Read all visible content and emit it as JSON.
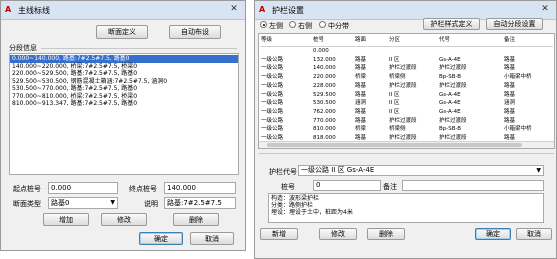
{
  "left": {
    "title": "主线标线",
    "btn_section_define": "断面定义",
    "btn_auto_layout": "自动布设",
    "group_label": "分段信息",
    "segments": [
      "0.000~140.000, 路基:7#2.5#7.5, 路基0",
      "140.000~220.000, 桥梁:7#2.5#7.5, 桥梁0",
      "220.000~529.500, 路基:7#2.5#7.5, 路基0",
      "529.500~530.500, 钢筋混凝土箱涵:7#2.5#7.5, 涵洞0",
      "530.500~770.000, 路基:7#2.5#7.5, 路基0",
      "770.000~810.000, 桥梁:7#2.5#7.5, 桥梁0",
      "810.000~913.347, 路基:7#2.5#7.5, 路基0"
    ],
    "start_label": "起点桩号",
    "start_value": "0.000",
    "end_label": "终点桩号",
    "end_value": "140.000",
    "type_label": "断面类型",
    "type_value": "路基0",
    "desc_label": "说明",
    "desc_value": "路基:7#2.5#7.5",
    "btn_add": "增加",
    "btn_modify": "修改",
    "btn_delete": "删除",
    "btn_ok": "确定",
    "btn_cancel": "取消"
  },
  "right": {
    "title": "护栏设置",
    "radio_left": "左侧",
    "radio_right": "右侧",
    "radio_median": "中分带",
    "btn_style": "护栏样式定义",
    "btn_auto": "自动分段设置",
    "headers": [
      "等级",
      "桩号",
      "路面",
      "分区",
      "代号",
      "备注"
    ],
    "rows": [
      [
        "",
        "0.000",
        "",
        "",
        "",
        ""
      ],
      [
        "一级公路",
        "132.000",
        "路基",
        "II 区",
        "Gs-A-4E",
        "路基"
      ],
      [
        "一级公路",
        "140.000",
        "路基",
        "护栏过渡段",
        "护栏过渡段",
        "路基"
      ],
      [
        "一级公路",
        "220.000",
        "桥梁",
        "桥梁侧",
        "Bp-SB-B",
        "小箱梁中桥"
      ],
      [
        "一级公路",
        "228.000",
        "路基",
        "护栏过渡段",
        "护栏过渡段",
        "路基"
      ],
      [
        "一级公路",
        "529.500",
        "路基",
        "II 区",
        "Gs-A-4E",
        "路基"
      ],
      [
        "一级公路",
        "530.500",
        "涵洞",
        "II 区",
        "Gs-A-4E",
        "涵洞"
      ],
      [
        "一级公路",
        "762.000",
        "路基",
        "II 区",
        "Gs-A-4E",
        "路基"
      ],
      [
        "一级公路",
        "770.000",
        "路基",
        "护栏过渡段",
        "护栏过渡段",
        "路基"
      ],
      [
        "一级公路",
        "810.000",
        "桥梁",
        "桥梁侧",
        "Bp-SB-B",
        "小箱梁中桥"
      ],
      [
        "一级公路",
        "818.000",
        "路基",
        "护栏过渡段",
        "护栏过渡段",
        "路基"
      ],
      [
        "一级公路",
        "913.347",
        "路基",
        "II 区",
        "Gs-A-4E",
        "路基"
      ]
    ],
    "code_label": "护栏代号",
    "code_value": "一级公路 II 区 Gs-A-4E",
    "pile_label": "桩号",
    "pile_value": "0",
    "remark_label": "备注",
    "remark_value": "",
    "info_lines": [
      "构造：波形梁护栏",
      "分类：路侧护栏",
      "埋设：埋设于土中，桩距为4米"
    ],
    "btn_add": "新增",
    "btn_modify": "修改",
    "btn_delete": "删除",
    "btn_ok": "确定",
    "btn_cancel": "取消"
  }
}
